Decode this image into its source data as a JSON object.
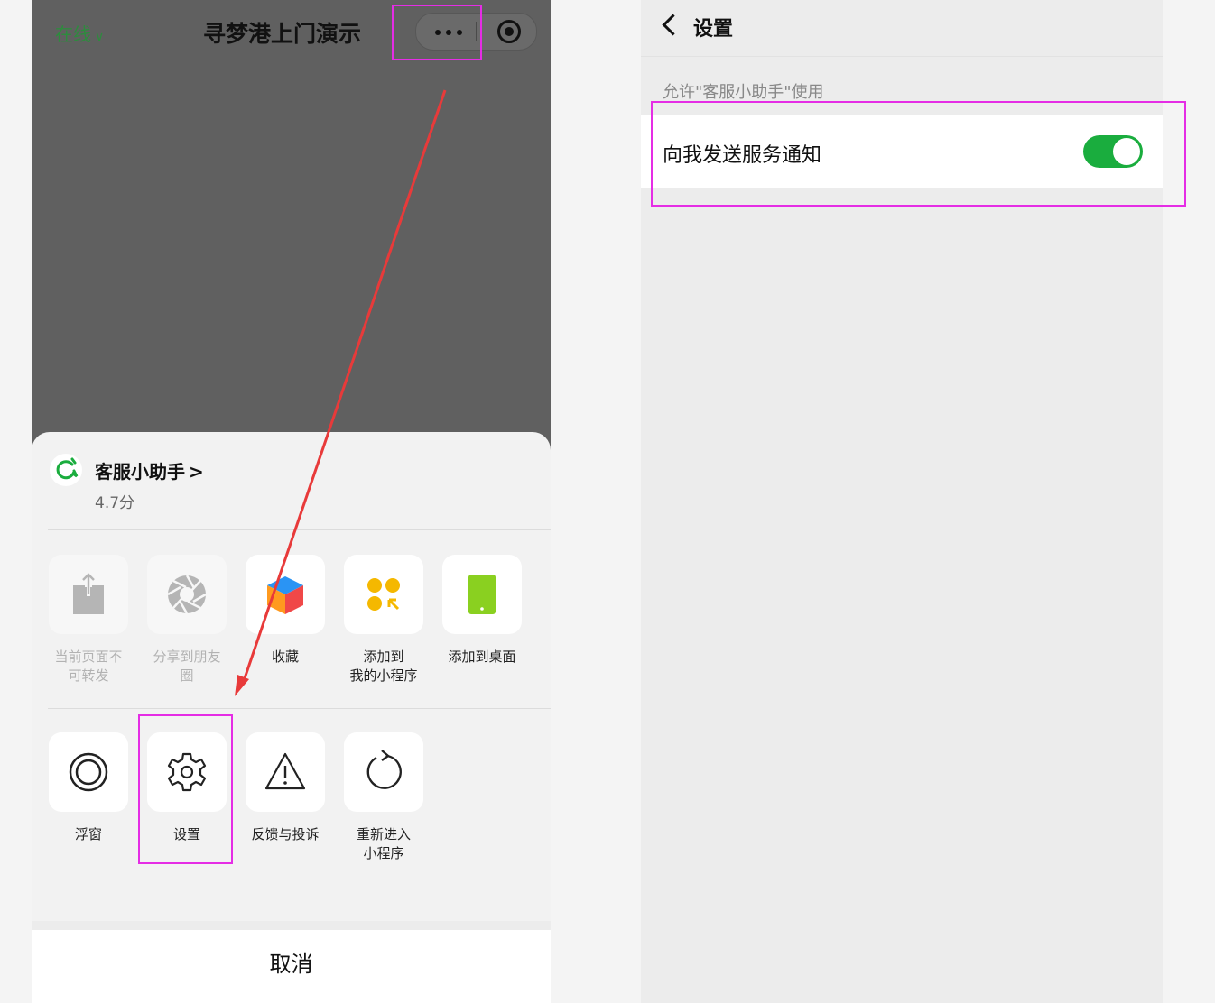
{
  "left": {
    "status_label": "在线",
    "title": "寻梦港上门演示",
    "capsule": {
      "more_icon": "more-dots-icon",
      "exit_icon": "target-circle-icon"
    },
    "app": {
      "name": "客服小助手",
      "name_arrow": ">",
      "score": "4.7分"
    },
    "row1": [
      {
        "label": "当前页面不可转发",
        "icon": "share-upload-icon",
        "disabled": true
      },
      {
        "label": "分享到朋友圈",
        "icon": "moments-aperture-icon",
        "disabled": true
      },
      {
        "label": "收藏",
        "icon": "favorite-cube-icon",
        "disabled": false
      },
      {
        "label": "添加到\n我的小程序",
        "icon": "add-to-my-miniprogram-icon",
        "disabled": false
      },
      {
        "label": "添加到桌面",
        "icon": "add-to-desktop-icon",
        "disabled": false
      }
    ],
    "row2": [
      {
        "label": "浮窗",
        "icon": "floating-window-icon"
      },
      {
        "label": "设置",
        "icon": "gear-icon"
      },
      {
        "label": "反馈与投诉",
        "icon": "warning-triangle-icon"
      },
      {
        "label": "重新进入\n小程序",
        "icon": "reload-icon"
      }
    ],
    "cancel_label": "取消",
    "colors": {
      "highlight": "#e52de5",
      "arrow": "#e83a3a",
      "online": "#2e8b3e"
    }
  },
  "right": {
    "nav_title": "设置",
    "section_label": "允许\"客服小助手\"使用",
    "row_label": "向我发送服务通知",
    "toggle_on": true,
    "colors": {
      "toggle": "#1aad3e"
    }
  }
}
